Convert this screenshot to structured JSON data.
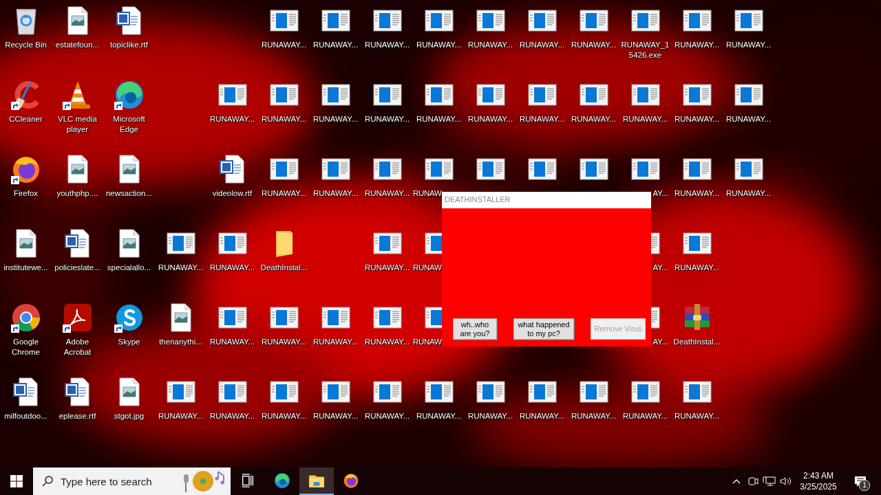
{
  "desktop": {
    "rows": [
      [
        {
          "kind": "recycle-bin",
          "label": "Recycle Bin"
        },
        {
          "kind": "image-file",
          "label": "estatefoun..."
        },
        {
          "kind": "word-file",
          "label": "topiclike.rtf"
        },
        {
          "kind": "empty"
        },
        {
          "kind": "empty"
        },
        {
          "kind": "app-window",
          "label": "RUNAWAY..."
        },
        {
          "kind": "app-window",
          "label": "RUNAWAY..."
        },
        {
          "kind": "app-window",
          "label": "RUNAWAY..."
        },
        {
          "kind": "app-window",
          "label": "RUNAWAY..."
        },
        {
          "kind": "app-window",
          "label": "RUNAWAY..."
        },
        {
          "kind": "app-window",
          "label": "RUNAWAY..."
        },
        {
          "kind": "app-window",
          "label": "RUNAWAY..."
        },
        {
          "kind": "app-window",
          "label": "RUNAWAY_15426.exe"
        },
        {
          "kind": "app-window",
          "label": "RUNAWAY..."
        },
        {
          "kind": "app-window",
          "label": "RUNAWAY..."
        }
      ],
      [
        {
          "kind": "ccleaner",
          "label": "CCleaner",
          "shortcut": true
        },
        {
          "kind": "vlc",
          "label": "VLC media player",
          "shortcut": true
        },
        {
          "kind": "edge",
          "label": "Microsoft Edge",
          "shortcut": true
        },
        {
          "kind": "empty"
        },
        {
          "kind": "app-window",
          "label": "RUNAWAY..."
        },
        {
          "kind": "app-window",
          "label": "RUNAWAY..."
        },
        {
          "kind": "app-window",
          "label": "RUNAWAY..."
        },
        {
          "kind": "app-window",
          "label": "RUNAWAY..."
        },
        {
          "kind": "app-window",
          "label": "RUNAWAY..."
        },
        {
          "kind": "app-window",
          "label": "RUNAWAY..."
        },
        {
          "kind": "app-window",
          "label": "RUNAWAY..."
        },
        {
          "kind": "app-window",
          "label": "RUNAWAY..."
        },
        {
          "kind": "app-window",
          "label": "RUNAWAY..."
        },
        {
          "kind": "app-window",
          "label": "RUNAWAY..."
        },
        {
          "kind": "app-window",
          "label": "RUNAWAY..."
        }
      ],
      [
        {
          "kind": "firefox",
          "label": "Firefox",
          "shortcut": true
        },
        {
          "kind": "image-file",
          "label": "youthphp...."
        },
        {
          "kind": "image-file",
          "label": "newsaction..."
        },
        {
          "kind": "empty"
        },
        {
          "kind": "word-file",
          "label": "videolow.rtf"
        },
        {
          "kind": "app-window",
          "label": "RUNAWAY..."
        },
        {
          "kind": "app-window",
          "label": "RUNAWAY..."
        },
        {
          "kind": "app-window",
          "label": "RUNAWAY..."
        },
        {
          "kind": "app-window",
          "label": "RUNAW",
          "clipped_right": true
        },
        {
          "kind": "app-window"
        },
        {
          "kind": "app-window"
        },
        {
          "kind": "app-window"
        },
        {
          "kind": "app-window",
          "label": "AY...",
          "clipped_left": true
        },
        {
          "kind": "app-window",
          "label": "RUNAWAY..."
        },
        {
          "kind": "app-window",
          "label": "RUNAWAY..."
        }
      ],
      [
        {
          "kind": "image-file",
          "label": "institutewe..."
        },
        {
          "kind": "word-file",
          "label": "policieslate..."
        },
        {
          "kind": "image-file",
          "label": "specialallo..."
        },
        {
          "kind": "app-window",
          "label": "RUNAWAY..."
        },
        {
          "kind": "app-window",
          "label": "RUNAWAY..."
        },
        {
          "kind": "folder",
          "label": "DeathInstal..."
        },
        {
          "kind": "empty"
        },
        {
          "kind": "app-window",
          "label": "RUNAWAY..."
        },
        {
          "kind": "app-window",
          "label": "RUNAW",
          "clipped_right": true
        },
        {
          "kind": "empty"
        },
        {
          "kind": "empty"
        },
        {
          "kind": "empty"
        },
        {
          "kind": "app-window",
          "label": "AY...",
          "clipped_left": true
        },
        {
          "kind": "app-window",
          "label": "RUNAWAY..."
        }
      ],
      [
        {
          "kind": "chrome",
          "label": "Google Chrome",
          "shortcut": true
        },
        {
          "kind": "acrobat",
          "label": "Adobe Acrobat",
          "shortcut": true
        },
        {
          "kind": "skype",
          "label": "Skype",
          "shortcut": true
        },
        {
          "kind": "image-file",
          "label": "thenanythi..."
        },
        {
          "kind": "app-window",
          "label": "RUNAWAY..."
        },
        {
          "kind": "app-window",
          "label": "RUNAWAY..."
        },
        {
          "kind": "app-window",
          "label": "RUNAWAY..."
        },
        {
          "kind": "app-window",
          "label": "RUNAWAY..."
        },
        {
          "kind": "app-window",
          "label": "RUNAW",
          "clipped_right": true
        },
        {
          "kind": "empty"
        },
        {
          "kind": "empty"
        },
        {
          "kind": "empty"
        },
        {
          "kind": "app-window",
          "label": "AY...",
          "clipped_left": true
        },
        {
          "kind": "winrar",
          "label": "DeathInstal..."
        }
      ],
      [
        {
          "kind": "word-file",
          "label": "milfoutdoo..."
        },
        {
          "kind": "word-file",
          "label": "eplease.rtf"
        },
        {
          "kind": "image-file",
          "label": "stgot.jpg"
        },
        {
          "kind": "app-window",
          "label": "RUNAWAY..."
        },
        {
          "kind": "app-window",
          "label": "RUNAWAY..."
        },
        {
          "kind": "app-window",
          "label": "RUNAWAY..."
        },
        {
          "kind": "app-window",
          "label": "RUNAWAY..."
        },
        {
          "kind": "app-window",
          "label": "RUNAWAY..."
        },
        {
          "kind": "app-window",
          "label": "RUNAWAY..."
        },
        {
          "kind": "app-window",
          "label": "RUNAWAY..."
        },
        {
          "kind": "app-window",
          "label": "RUNAWAY..."
        },
        {
          "kind": "app-window",
          "label": "RUNAWAY..."
        },
        {
          "kind": "app-window",
          "label": "RUNAWAY..."
        },
        {
          "kind": "app-window",
          "label": "RUNAWAY..."
        }
      ]
    ]
  },
  "dialog": {
    "title": "DEATHINSTALLER",
    "buttons": [
      {
        "label": "wh..who are you?",
        "disabled": false
      },
      {
        "label": "what happened to my pc?",
        "disabled": false
      },
      {
        "label": "Remove Virus",
        "disabled": true
      }
    ]
  },
  "taskbar": {
    "search": {
      "placeholder": "Type here to search"
    },
    "apps": [
      {
        "kind": "task-view",
        "active": false
      },
      {
        "kind": "edge",
        "active": false
      },
      {
        "kind": "explorer",
        "active": true
      },
      {
        "kind": "firefox",
        "active": false
      }
    ],
    "clock": {
      "time": "2:43 AM",
      "date": "3/25/2025"
    },
    "notifications": {
      "count": "1"
    }
  }
}
